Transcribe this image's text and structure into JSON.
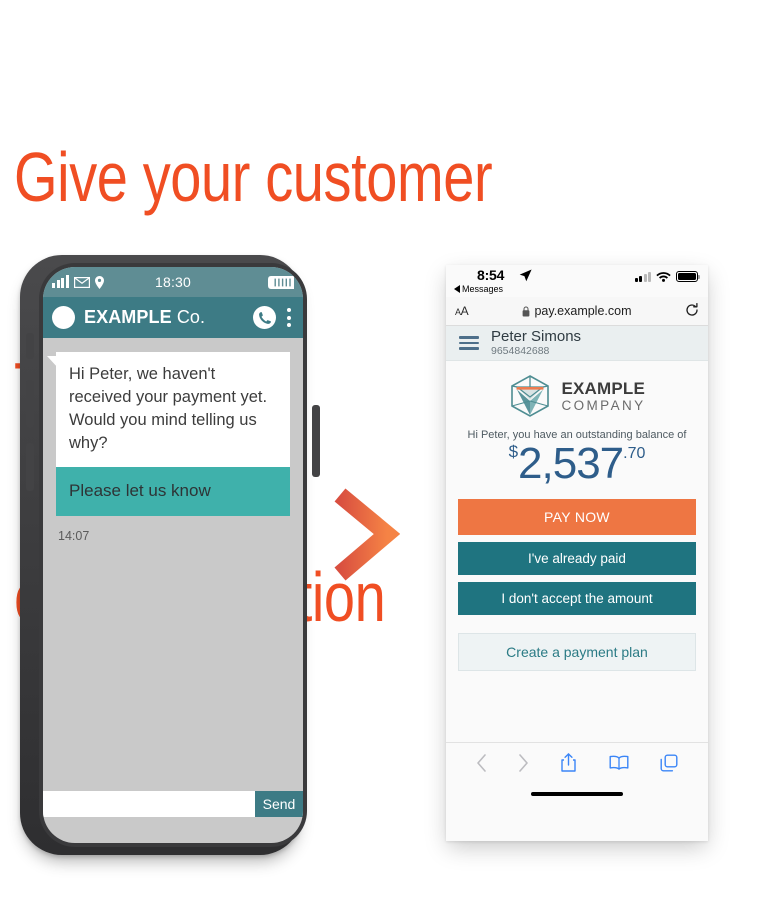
{
  "headline": {
    "line1": "Give your customer",
    "line2": "TWO WAY",
    "line3": "communication",
    "color": "#f04e23"
  },
  "arrow": {
    "name": "right-arrow",
    "color_start": "#e0503f",
    "color_end": "#f58345"
  },
  "left_phone": {
    "status_bar": {
      "time": "18:30",
      "icons": [
        "signal-bars-icon",
        "envelope-icon",
        "location-pin-icon",
        "battery-icon"
      ],
      "background": "#5f8d94"
    },
    "app_bar": {
      "title_strong": "EXAMPLE",
      "title_light": " Co.",
      "background": "#3d7b85",
      "avatar": "contact-avatar",
      "call_icon": "phone-icon",
      "menu_icon": "overflow-menu-icon"
    },
    "messages": [
      {
        "type": "incoming-text",
        "text": "Hi Peter, we haven't received your payment yet. Would you mind telling us why?",
        "background": "#ffffff"
      },
      {
        "type": "incoming-action",
        "text": "Please let us know",
        "background": "#3fb1ab"
      }
    ],
    "timestamp": "14:07",
    "composer": {
      "input_value": "",
      "input_placeholder": "",
      "send_label": "Send",
      "send_background": "#3d7b85"
    }
  },
  "right_phone": {
    "status_bar": {
      "time": "8:54",
      "location_icon": "location-arrow-icon",
      "back_label": "Messages",
      "back_icon": "back-triangle-icon",
      "signal_icon": "cellular-bars-icon",
      "wifi_icon": "wifi-icon",
      "battery_icon": "battery-icon"
    },
    "browser": {
      "text_size_label": "ᴀA",
      "lock_icon": "lock-icon",
      "url": "pay.example.com",
      "reload_icon": "reload-icon"
    },
    "page_header": {
      "menu_icon": "hamburger-menu-icon",
      "name": "Peter Simons",
      "account_number": "9654842688"
    },
    "logo": {
      "mark": "cube-logo-icon",
      "title": "EXAMPLE",
      "subtitle": "COMPANY"
    },
    "balance": {
      "intro": "Hi Peter, you have an outstanding balance of",
      "currency_symbol": "$",
      "amount_whole": "2,537",
      "amount_cents": ".70",
      "color": "#2e5d8a"
    },
    "buttons": [
      {
        "label": "PAY NOW",
        "style": "primary",
        "background": "#ee7643"
      },
      {
        "label": "I've already paid",
        "style": "secondary",
        "background": "#1f7480"
      },
      {
        "label": "I don't accept the amount",
        "style": "secondary",
        "background": "#1f7480"
      },
      {
        "label": "Create a payment plan",
        "style": "outline",
        "background": "#eef3f4"
      }
    ],
    "toolbar": {
      "back_icon": "chevron-left-icon",
      "forward_icon": "chevron-right-icon",
      "share_icon": "share-icon",
      "bookmarks_icon": "book-icon",
      "tabs_icon": "tabs-icon"
    }
  }
}
